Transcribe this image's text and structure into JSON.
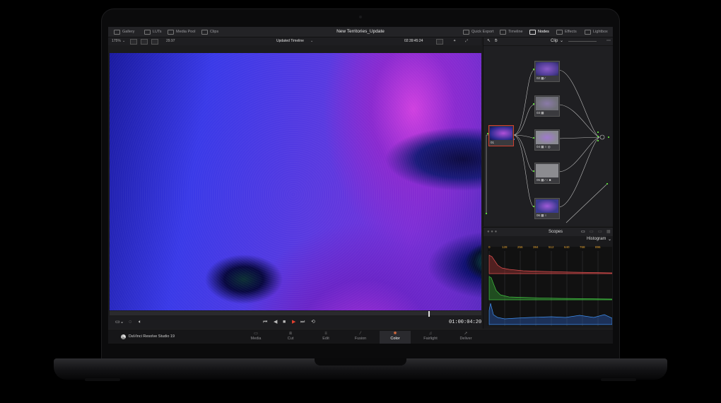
{
  "app": {
    "project_title": "New Territories_Update",
    "brand": "DaVinci Resolve Studio 19"
  },
  "topbar": {
    "left": [
      "Gallery",
      "LUTs",
      "Media Pool",
      "Clips"
    ],
    "right": [
      "Quick Export",
      "Timeline",
      "Nodes",
      "Effects",
      "Lightbox"
    ],
    "active": "Nodes"
  },
  "viewer_toolbar": {
    "zoom": "175%",
    "fps": "29.97",
    "timeline_name": "Updated Timeline",
    "source_timecode": "02:39:45:24"
  },
  "transport": {
    "timecode": "01:00:04:20"
  },
  "nodes": {
    "mode": "Clip",
    "items": [
      {
        "label": "01"
      },
      {
        "label": "02"
      },
      {
        "label": "03"
      },
      {
        "label": "04"
      },
      {
        "label": "05"
      },
      {
        "label": "06"
      }
    ]
  },
  "scopes": {
    "title": "Scopes",
    "mode": "Histogram",
    "ticks": [
      "0",
      "128",
      "256",
      "384",
      "512",
      "640",
      "768",
      "896"
    ]
  },
  "pages": [
    "Media",
    "Cut",
    "Edit",
    "Fusion",
    "Color",
    "Fairlight",
    "Deliver"
  ],
  "active_page": "Color",
  "colors": {
    "accent": "#e05030",
    "timecode_play": "#e0402f"
  }
}
